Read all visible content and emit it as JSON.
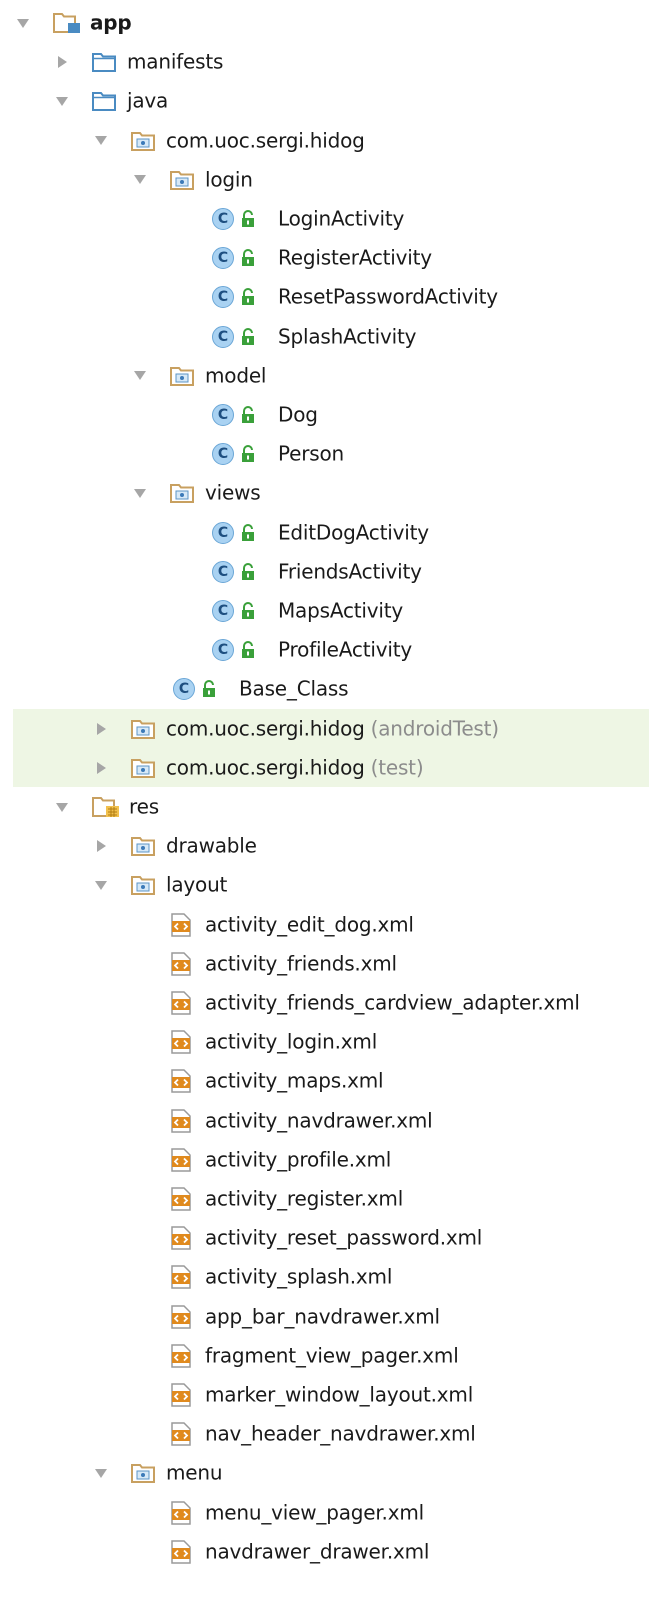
{
  "tree": {
    "nodes": [
      {
        "label": "app",
        "suffix": "",
        "depth": 0,
        "state": "expanded",
        "icon": "module-folder-icon",
        "bold": true,
        "highlight": false
      },
      {
        "label": "manifests",
        "suffix": "",
        "depth": 1,
        "state": "collapsed",
        "icon": "folder-icon",
        "bold": false,
        "highlight": false
      },
      {
        "label": "java",
        "suffix": "",
        "depth": 1,
        "state": "expanded",
        "icon": "folder-icon",
        "bold": false,
        "highlight": false
      },
      {
        "label": "com.uoc.sergi.hidog",
        "suffix": "",
        "depth": 2,
        "state": "expanded",
        "icon": "package-icon",
        "bold": false,
        "highlight": false
      },
      {
        "label": "login",
        "suffix": "",
        "depth": 3,
        "state": "expanded",
        "icon": "package-icon",
        "bold": false,
        "highlight": false
      },
      {
        "label": "LoginActivity",
        "suffix": "",
        "depth": 4,
        "state": "leaf",
        "icon": "class-icon",
        "bold": false,
        "highlight": false
      },
      {
        "label": "RegisterActivity",
        "suffix": "",
        "depth": 4,
        "state": "leaf",
        "icon": "class-icon",
        "bold": false,
        "highlight": false
      },
      {
        "label": "ResetPasswordActivity",
        "suffix": "",
        "depth": 4,
        "state": "leaf",
        "icon": "class-icon",
        "bold": false,
        "highlight": false
      },
      {
        "label": "SplashActivity",
        "suffix": "",
        "depth": 4,
        "state": "leaf",
        "icon": "class-icon",
        "bold": false,
        "highlight": false
      },
      {
        "label": "model",
        "suffix": "",
        "depth": 3,
        "state": "expanded",
        "icon": "package-icon",
        "bold": false,
        "highlight": false
      },
      {
        "label": "Dog",
        "suffix": "",
        "depth": 4,
        "state": "leaf",
        "icon": "class-icon",
        "bold": false,
        "highlight": false
      },
      {
        "label": "Person",
        "suffix": "",
        "depth": 4,
        "state": "leaf",
        "icon": "class-icon",
        "bold": false,
        "highlight": false
      },
      {
        "label": "views",
        "suffix": "",
        "depth": 3,
        "state": "expanded",
        "icon": "package-icon",
        "bold": false,
        "highlight": false
      },
      {
        "label": "EditDogActivity",
        "suffix": "",
        "depth": 4,
        "state": "leaf",
        "icon": "class-icon",
        "bold": false,
        "highlight": false
      },
      {
        "label": "FriendsActivity",
        "suffix": "",
        "depth": 4,
        "state": "leaf",
        "icon": "class-icon",
        "bold": false,
        "highlight": false
      },
      {
        "label": "MapsActivity",
        "suffix": "",
        "depth": 4,
        "state": "leaf",
        "icon": "class-icon",
        "bold": false,
        "highlight": false
      },
      {
        "label": "ProfileActivity",
        "suffix": "",
        "depth": 4,
        "state": "leaf",
        "icon": "class-icon",
        "bold": false,
        "highlight": false
      },
      {
        "label": "Base_Class",
        "suffix": "",
        "depth": 3,
        "state": "leaf",
        "icon": "class-icon",
        "bold": false,
        "highlight": false
      },
      {
        "label": "com.uoc.sergi.hidog",
        "suffix": "(androidTest)",
        "depth": 2,
        "state": "collapsed",
        "icon": "package-icon",
        "bold": false,
        "highlight": true
      },
      {
        "label": "com.uoc.sergi.hidog",
        "suffix": "(test)",
        "depth": 2,
        "state": "collapsed",
        "icon": "package-icon",
        "bold": false,
        "highlight": true
      },
      {
        "label": "res",
        "suffix": "",
        "depth": 1,
        "state": "expanded",
        "icon": "resources-folder-icon",
        "bold": false,
        "highlight": false
      },
      {
        "label": "drawable",
        "suffix": "",
        "depth": 2,
        "state": "collapsed",
        "icon": "package-icon",
        "bold": false,
        "highlight": false
      },
      {
        "label": "layout",
        "suffix": "",
        "depth": 2,
        "state": "expanded",
        "icon": "package-icon",
        "bold": false,
        "highlight": false
      },
      {
        "label": "activity_edit_dog.xml",
        "suffix": "",
        "depth": 3,
        "state": "leaf",
        "icon": "xml-file-icon",
        "bold": false,
        "highlight": false
      },
      {
        "label": "activity_friends.xml",
        "suffix": "",
        "depth": 3,
        "state": "leaf",
        "icon": "xml-file-icon",
        "bold": false,
        "highlight": false
      },
      {
        "label": "activity_friends_cardview_adapter.xml",
        "suffix": "",
        "depth": 3,
        "state": "leaf",
        "icon": "xml-file-icon",
        "bold": false,
        "highlight": false
      },
      {
        "label": "activity_login.xml",
        "suffix": "",
        "depth": 3,
        "state": "leaf",
        "icon": "xml-file-icon",
        "bold": false,
        "highlight": false
      },
      {
        "label": "activity_maps.xml",
        "suffix": "",
        "depth": 3,
        "state": "leaf",
        "icon": "xml-file-icon",
        "bold": false,
        "highlight": false
      },
      {
        "label": "activity_navdrawer.xml",
        "suffix": "",
        "depth": 3,
        "state": "leaf",
        "icon": "xml-file-icon",
        "bold": false,
        "highlight": false
      },
      {
        "label": "activity_profile.xml",
        "suffix": "",
        "depth": 3,
        "state": "leaf",
        "icon": "xml-file-icon",
        "bold": false,
        "highlight": false
      },
      {
        "label": "activity_register.xml",
        "suffix": "",
        "depth": 3,
        "state": "leaf",
        "icon": "xml-file-icon",
        "bold": false,
        "highlight": false
      },
      {
        "label": "activity_reset_password.xml",
        "suffix": "",
        "depth": 3,
        "state": "leaf",
        "icon": "xml-file-icon",
        "bold": false,
        "highlight": false
      },
      {
        "label": "activity_splash.xml",
        "suffix": "",
        "depth": 3,
        "state": "leaf",
        "icon": "xml-file-icon",
        "bold": false,
        "highlight": false
      },
      {
        "label": "app_bar_navdrawer.xml",
        "suffix": "",
        "depth": 3,
        "state": "leaf",
        "icon": "xml-file-icon",
        "bold": false,
        "highlight": false
      },
      {
        "label": "fragment_view_pager.xml",
        "suffix": "",
        "depth": 3,
        "state": "leaf",
        "icon": "xml-file-icon",
        "bold": false,
        "highlight": false
      },
      {
        "label": "marker_window_layout.xml",
        "suffix": "",
        "depth": 3,
        "state": "leaf",
        "icon": "xml-file-icon",
        "bold": false,
        "highlight": false
      },
      {
        "label": "nav_header_navdrawer.xml",
        "suffix": "",
        "depth": 3,
        "state": "leaf",
        "icon": "xml-file-icon",
        "bold": false,
        "highlight": false
      },
      {
        "label": "menu",
        "suffix": "",
        "depth": 2,
        "state": "expanded",
        "icon": "package-icon",
        "bold": false,
        "highlight": false
      },
      {
        "label": "menu_view_pager.xml",
        "suffix": "",
        "depth": 3,
        "state": "leaf",
        "icon": "xml-file-icon",
        "bold": false,
        "highlight": false
      },
      {
        "label": "navdrawer_drawer.xml",
        "suffix": "",
        "depth": 3,
        "state": "leaf",
        "icon": "xml-file-icon",
        "bold": false,
        "highlight": false
      }
    ]
  },
  "colors": {
    "highlight_row": "#eef6e4",
    "folder_blue": "#4a8bc2",
    "package_tan": "#c8a060",
    "class_circle": "#a9d2f2",
    "lock_green": "#3aa03a",
    "xml_orange": "#e08a1e",
    "suffix_gray": "#8c8c8c",
    "arrow_gray": "#a6a6a6"
  }
}
